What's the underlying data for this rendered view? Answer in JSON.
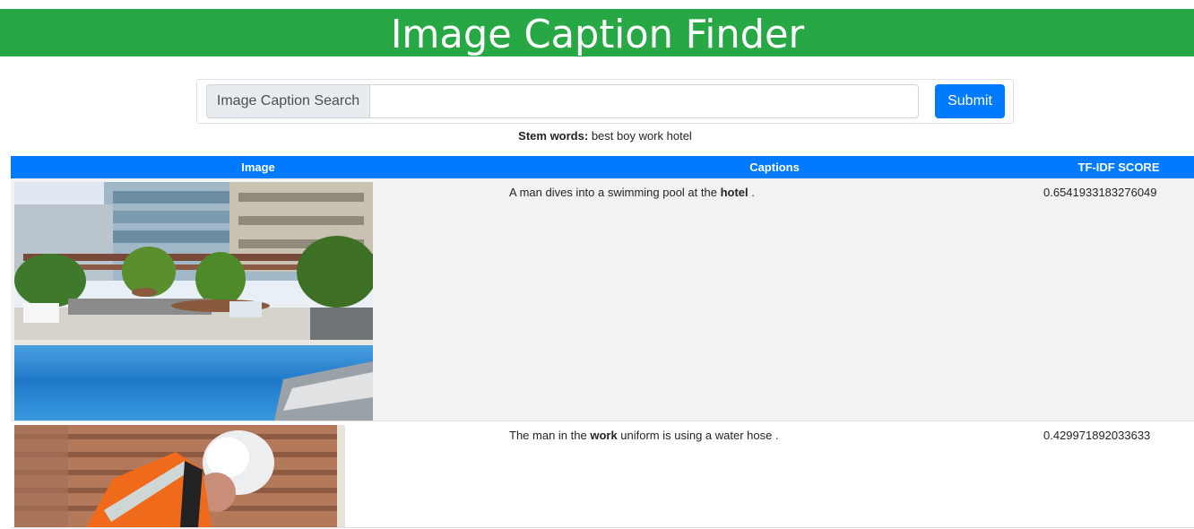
{
  "header": {
    "title": "Image Caption Finder"
  },
  "search": {
    "prepend_label": "Image Caption Search",
    "value": "",
    "placeholder": "",
    "submit_label": "Submit"
  },
  "stem": {
    "label": "Stem words:",
    "words": "best boy work hotel"
  },
  "table": {
    "columns": [
      "Image",
      "Captions",
      "TF-IDF SCORE"
    ],
    "rows": [
      {
        "image_alt": "Man diving into a hotel swimming pool",
        "caption_before": "A man dives into a swimming pool at the ",
        "caption_highlight": "hotel",
        "caption_after": " .",
        "score": "0.6541933183276049"
      },
      {
        "image_alt": "Worker in orange vest and white hard hat",
        "caption_before": "The man in the ",
        "caption_highlight": "work",
        "caption_after": " uniform is using a water hose .",
        "score": "0.429971892033633"
      }
    ]
  },
  "colors": {
    "banner": "#28a745",
    "table_header": "#007bff",
    "submit": "#007bff",
    "odd_row": "#f2f2f2"
  }
}
